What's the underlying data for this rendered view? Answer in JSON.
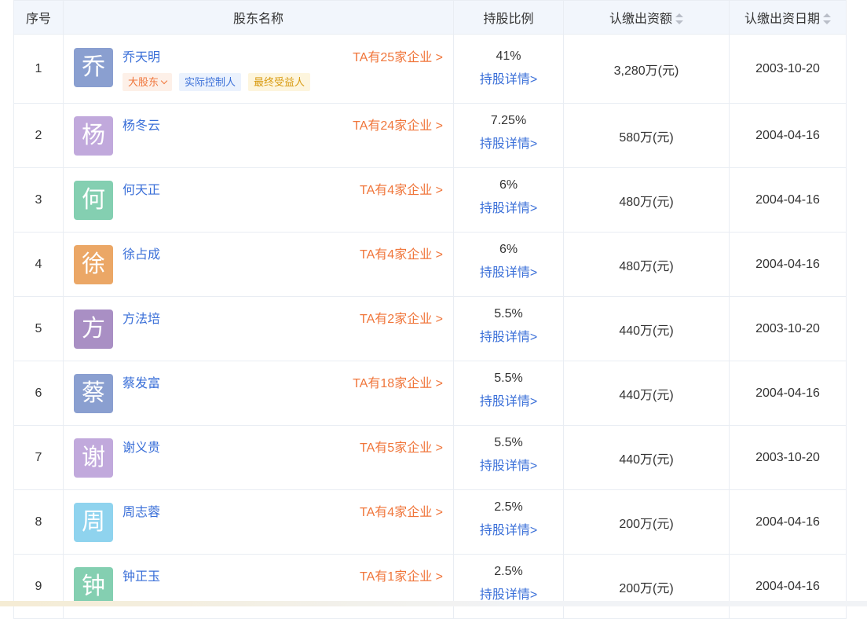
{
  "header": {
    "index": "序号",
    "name": "股东名称",
    "ratio": "持股比例",
    "amount": "认缴出资额",
    "date": "认缴出资日期"
  },
  "rows": [
    {
      "index": "1",
      "avatar": "乔",
      "avatar_color": "#8a9fd0",
      "name": "乔天明",
      "companies": "TA有25家企业 >",
      "ratio": "41%",
      "detail": "持股详情>",
      "amount": "3,280万(元)",
      "date": "2003-10-20",
      "tags": {
        "major": "大股东",
        "ctrl": "实际控制人",
        "benef": "最终受益人"
      }
    },
    {
      "index": "2",
      "avatar": "杨",
      "avatar_color": "#c1a9dc",
      "name": "杨冬云",
      "companies": "TA有24家企业 >",
      "ratio": "7.25%",
      "detail": "持股详情>",
      "amount": "580万(元)",
      "date": "2004-04-16"
    },
    {
      "index": "3",
      "avatar": "何",
      "avatar_color": "#84cfb1",
      "name": "何天正",
      "companies": "TA有4家企业 >",
      "ratio": "6%",
      "detail": "持股详情>",
      "amount": "480万(元)",
      "date": "2004-04-16"
    },
    {
      "index": "4",
      "avatar": "徐",
      "avatar_color": "#eba766",
      "name": "徐占成",
      "companies": "TA有4家企业 >",
      "ratio": "6%",
      "detail": "持股详情>",
      "amount": "480万(元)",
      "date": "2004-04-16"
    },
    {
      "index": "5",
      "avatar": "方",
      "avatar_color": "#a98fc4",
      "name": "方法培",
      "companies": "TA有2家企业 >",
      "ratio": "5.5%",
      "detail": "持股详情>",
      "amount": "440万(元)",
      "date": "2003-10-20"
    },
    {
      "index": "6",
      "avatar": "蔡",
      "avatar_color": "#8a9fd0",
      "name": "蔡发富",
      "companies": "TA有18家企业 >",
      "ratio": "5.5%",
      "detail": "持股详情>",
      "amount": "440万(元)",
      "date": "2004-04-16"
    },
    {
      "index": "7",
      "avatar": "谢",
      "avatar_color": "#c1a9dc",
      "name": "谢义贵",
      "companies": "TA有5家企业 >",
      "ratio": "5.5%",
      "detail": "持股详情>",
      "amount": "440万(元)",
      "date": "2003-10-20"
    },
    {
      "index": "8",
      "avatar": "周",
      "avatar_color": "#8fd3ee",
      "name": "周志蓉",
      "companies": "TA有4家企业 >",
      "ratio": "2.5%",
      "detail": "持股详情>",
      "amount": "200万(元)",
      "date": "2004-04-16"
    },
    {
      "index": "9",
      "avatar": "钟",
      "avatar_color": "#84cfb1",
      "name": "钟正玉",
      "companies": "TA有1家企业 >",
      "ratio": "2.5%",
      "detail": "持股详情>",
      "amount": "200万(元)",
      "date": "2004-04-16"
    }
  ]
}
